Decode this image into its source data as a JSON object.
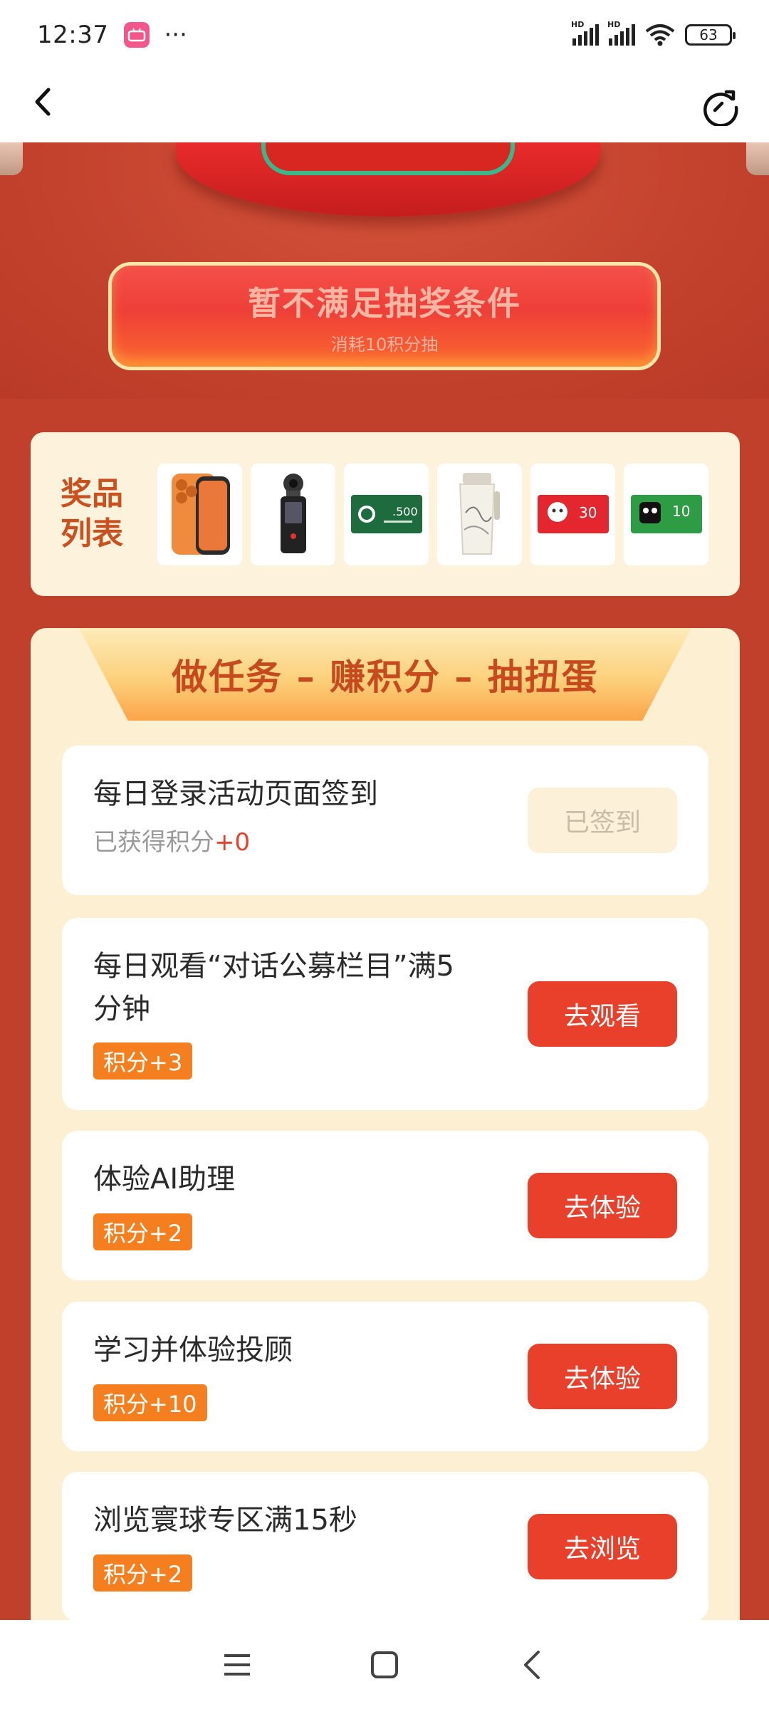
{
  "status_bar": {
    "time": "12:37",
    "app_icon_label": "bilibili",
    "more": "···",
    "network1": "HD",
    "network2": "HD",
    "battery": "63"
  },
  "nav": {
    "back_icon": "back-arrow-icon",
    "refresh_icon": "refresh-icon"
  },
  "draw": {
    "title": "暂不满足抽奖条件",
    "subtitle": "消耗10积分抽"
  },
  "prizes": {
    "label": "奖品列表",
    "items": [
      {
        "name": "phone",
        "color": "#f08a3c"
      },
      {
        "name": "pocket-camera",
        "color": "#222222"
      },
      {
        "name": "starbucks-card",
        "text": ".500",
        "color": "#1e6b3d"
      },
      {
        "name": "tumbler",
        "color": "#f3f0e8"
      },
      {
        "name": "jd-card",
        "text": "30",
        "color": "#e4262e"
      },
      {
        "name": "tmall-card",
        "text": "10",
        "color": "#2e9b45"
      }
    ]
  },
  "tasks": {
    "header": "做任务 – 赚积分 – 抽扭蛋",
    "items": [
      {
        "title": "每日登录活动页面签到",
        "earned_label": "已获得积分",
        "earned_value": "+0",
        "button": "已签到",
        "done": true
      },
      {
        "title": "每日观看“对话公募栏目”满5分钟",
        "title_line1": "每日观看“对话公募栏目”满5",
        "title_line2": "分钟",
        "tag": "积分+3",
        "button": "去观看"
      },
      {
        "title": "体验AI助理",
        "tag": "积分+2",
        "button": "去体验"
      },
      {
        "title": "学习并体验投顾",
        "tag": "积分+10",
        "button": "去体验"
      },
      {
        "title": "浏览寰球专区满15秒",
        "tag": "积分+2",
        "button": "去浏览"
      }
    ]
  },
  "colors": {
    "background": "#c0402b",
    "primary_button": "#e8402a",
    "tag": "#f57f1f",
    "card": "#fdefd2"
  }
}
